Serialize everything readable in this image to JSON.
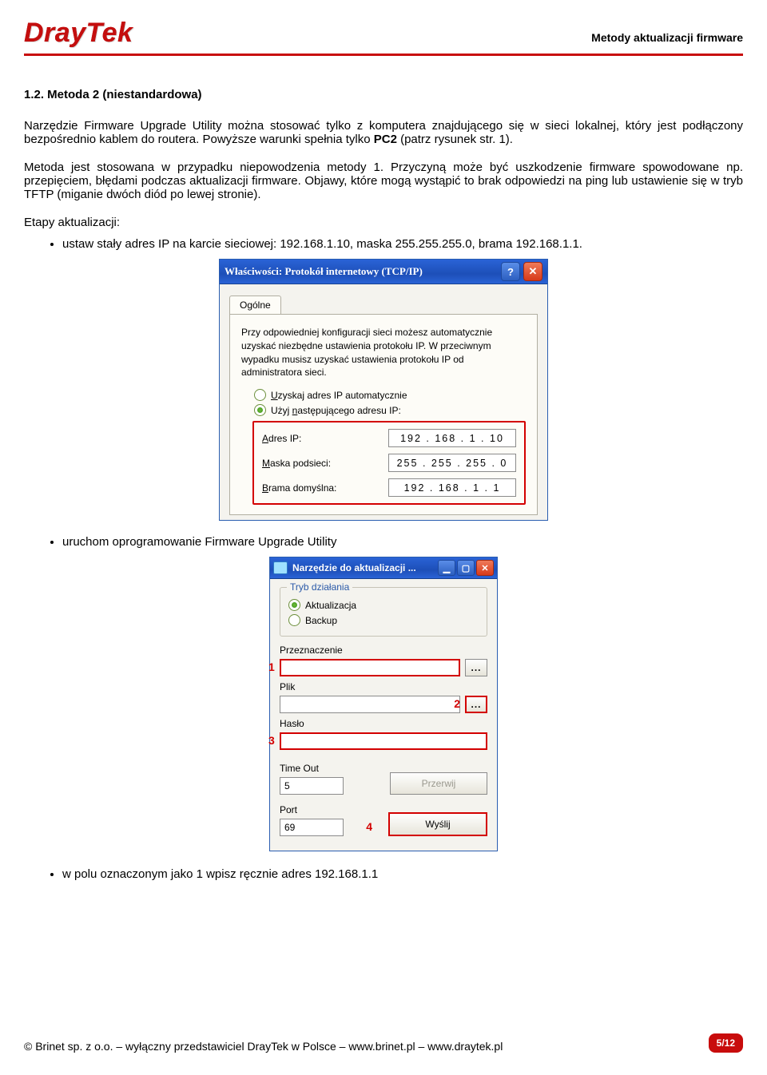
{
  "header": {
    "logo_text": "DrayTek",
    "title": "Metody aktualizacji firmware"
  },
  "section": {
    "heading": "1.2. Metoda 2 (niestandardowa)",
    "p1_a": "Narzędzie Firmware Upgrade Utility można stosować tylko z komputera znajdującego się w sieci lokalnej, który jest podłączony bezpośrednio kablem do routera. Powyższe warunki spełnia tylko ",
    "p1_b": "PC2",
    "p1_c": " (patrz rysunek str. 1).",
    "p2": "Metoda jest stosowana w przypadku niepowodzenia metody 1. Przyczyną może być uszkodzenie firmware spowodowane np. przepięciem, błędami podczas aktualizacji firmware. Objawy, które mogą wystąpić to brak odpowiedzi na ping lub ustawienie się w tryb TFTP (miganie dwóch diód po lewej stronie).",
    "steps_intro": "Etapy aktualizacji:",
    "step1": "ustaw stały adres IP na karcie sieciowej: 192.168.1.10, maska 255.255.255.0, brama 192.168.1.1.",
    "step2": "uruchom oprogramowanie Firmware Upgrade Utility",
    "step3": "w polu oznaczonym jako 1 wpisz ręcznie adres 192.168.1.1"
  },
  "tcpip": {
    "title": "Właściwości: Protokół internetowy (TCP/IP)",
    "help_btn": "?",
    "close_btn": "✕",
    "tab": "Ogólne",
    "help": "Przy odpowiedniej konfiguracji sieci możesz automatycznie uzyskać niezbędne ustawienia protokołu IP. W przeciwnym wypadku musisz uzyskać ustawienia protokołu IP od administratora sieci.",
    "radio_auto": "Uzyskaj adres IP automatycznie",
    "radio_manual": "Użyj następującego adresu IP:",
    "ip_label": "Adres IP:",
    "ip_value": "192 . 168 .   1   .  10",
    "mask_label": "Maska podsieci:",
    "mask_value": "255 . 255 . 255 .   0",
    "gw_label": "Brama domyślna:",
    "gw_value": "192 . 168 .   1   .   1"
  },
  "fw": {
    "title": "Narzędzie do aktualizacji ...",
    "min": "▁",
    "max": "▢",
    "close": "✕",
    "group_legend": "Tryb działania",
    "radio_update": "Aktualizacja",
    "radio_backup": "Backup",
    "dest_label": "Przeznaczenie",
    "file_label": "Plik",
    "pass_label": "Hasło",
    "timeout_label": "Time Out",
    "timeout_value": "5",
    "port_label": "Port",
    "port_value": "69",
    "cancel_btn": "Przerwij",
    "send_btn": "Wyślij",
    "browse": "...",
    "badge1": "1",
    "badge2": "2",
    "badge3": "3",
    "badge4": "4"
  },
  "footer": {
    "text": "© Brinet sp. z o.o. – wyłączny przedstawiciel DrayTek w Polsce – www.brinet.pl – www.draytek.pl",
    "page": "5/12"
  }
}
